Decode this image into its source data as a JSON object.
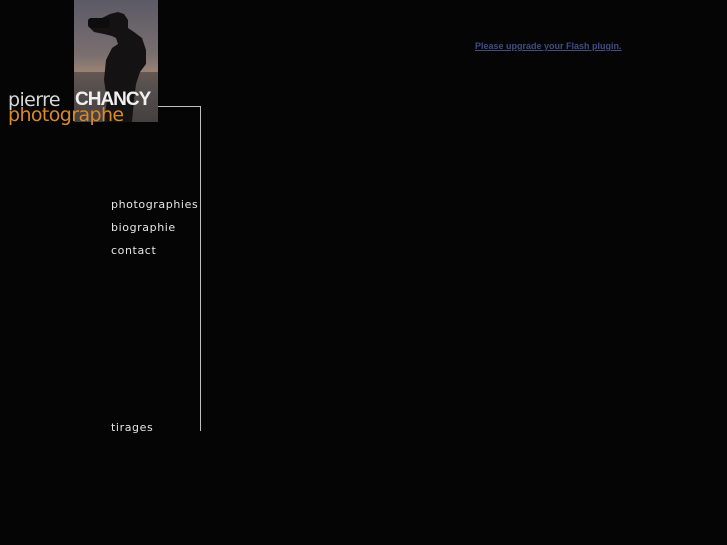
{
  "brand": {
    "first_name": "pierre",
    "last_name": "CHANCY",
    "role": "photographe"
  },
  "nav": {
    "items": [
      {
        "label": "photographies"
      },
      {
        "label": "biographie"
      },
      {
        "label": "contact"
      },
      {
        "label": "tirages"
      }
    ]
  },
  "flash_notice": {
    "link_text": "Please upgrade your Flash plugin."
  },
  "colors": {
    "background": "#050505",
    "role_accent": "#d98a2a",
    "link": "#3f4d84"
  }
}
